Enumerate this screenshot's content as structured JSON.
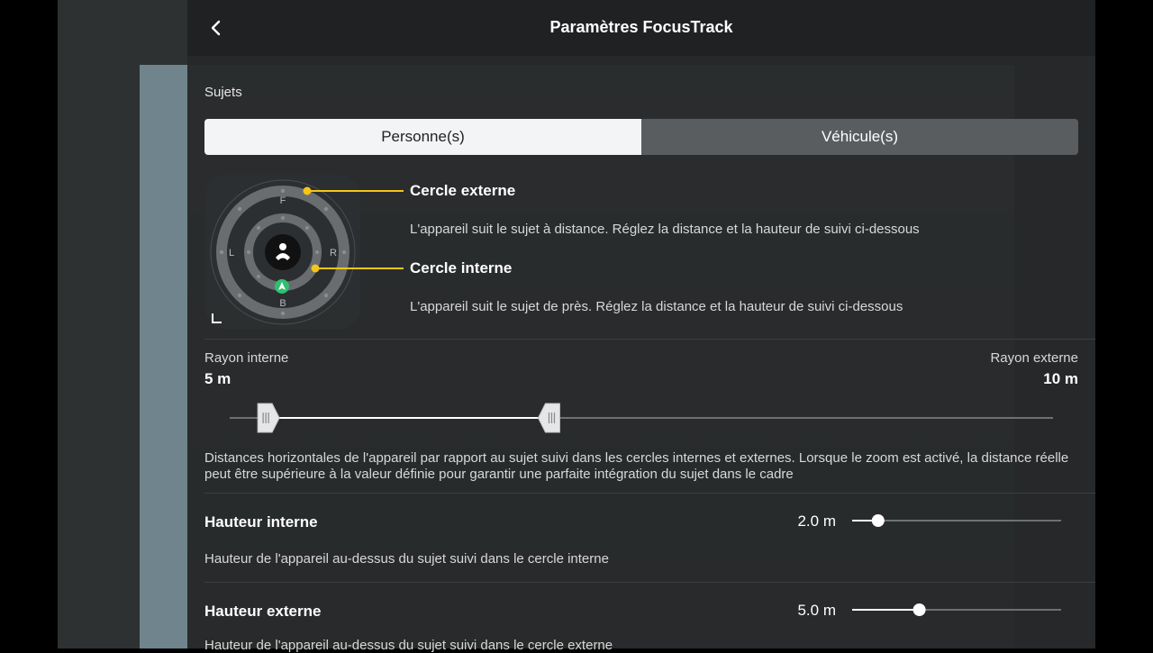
{
  "header": {
    "title": "Paramètres FocusTrack",
    "back_icon": "chevron-left-icon"
  },
  "subjects": {
    "label": "Sujets",
    "tabs": [
      {
        "label": "Personne(s)",
        "active": true
      },
      {
        "label": "Véhicule(s)",
        "active": false
      }
    ]
  },
  "radar": {
    "front": "F",
    "back": "B",
    "left": "L",
    "right": "R",
    "accent_color": "#f5c518",
    "drone_color": "#2fbf71"
  },
  "outer_circle": {
    "title": "Cercle externe",
    "description": "L'appareil suit le sujet à distance. Réglez la distance et la hauteur de suivi ci-dessous"
  },
  "inner_circle": {
    "title": "Cercle interne",
    "description": "L'appareil suit le sujet de près. Réglez la distance et la hauteur de suivi ci-dessous"
  },
  "radius": {
    "inner_label": "Rayon interne",
    "inner_value": "5 m",
    "outer_label": "Rayon externe",
    "outer_value": "10 m",
    "inner_fraction": 0.045,
    "outer_fraction": 0.39,
    "description": "Distances horizontales de l'appareil par rapport au sujet suivi dans les cercles internes et externes. Lorsque le zoom est activé, la distance réelle peut être supérieure à la valeur définie pour garantir une parfaite intégration du sujet dans le cadre"
  },
  "inner_height": {
    "title": "Hauteur interne",
    "value": "2.0 m",
    "fraction": 0.1,
    "description": "Hauteur de l'appareil au-dessus du sujet suivi dans le cercle interne"
  },
  "outer_height": {
    "title": "Hauteur externe",
    "value": "5.0 m",
    "fraction": 0.31,
    "description": "Hauteur de l'appareil au-dessus du sujet suivi dans le cercle externe"
  }
}
